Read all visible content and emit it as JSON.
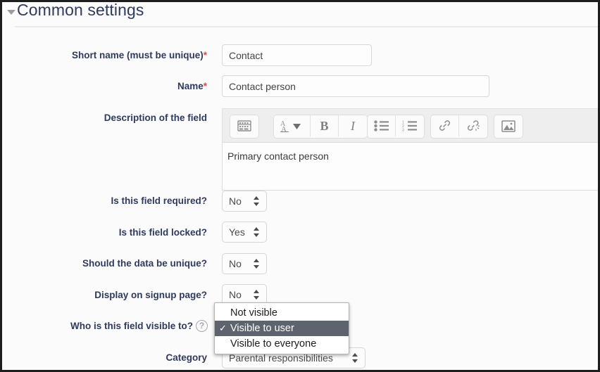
{
  "section": {
    "title": "Common settings",
    "collapse_icon": "triangle-down-icon"
  },
  "fields": {
    "short_name": {
      "label": "Short name (must be unique)",
      "required_marker": "*",
      "value": "Contact"
    },
    "name": {
      "label": "Name",
      "required_marker": "*",
      "value": "Contact person"
    },
    "description": {
      "label": "Description of the field",
      "value": "Primary contact person"
    },
    "is_required": {
      "label": "Is this field required?",
      "value": "No"
    },
    "is_locked": {
      "label": "Is this field locked?",
      "value": "Yes"
    },
    "unique_data": {
      "label": "Should the data be unique?",
      "value": "No"
    },
    "signup_page": {
      "label": "Display on signup page?",
      "value": "No"
    },
    "visible_to": {
      "label": "Who is this field visible to?",
      "help_icon": "question-mark-icon",
      "help_glyph": "?",
      "value": "Visible to user"
    },
    "category": {
      "label": "Category",
      "value": "Parental responsibilities"
    }
  },
  "editor_toolbar": {
    "buttons": [
      {
        "name": "expand-toolbar-icon",
        "glyph": ""
      },
      {
        "name": "font-size-icon",
        "glyph": ""
      },
      {
        "name": "bold-icon",
        "glyph": "B"
      },
      {
        "name": "italic-icon",
        "glyph": "I"
      },
      {
        "name": "bulleted-list-icon",
        "glyph": ""
      },
      {
        "name": "numbered-list-icon",
        "glyph": ""
      },
      {
        "name": "link-icon",
        "glyph": ""
      },
      {
        "name": "unlink-icon",
        "glyph": ""
      },
      {
        "name": "insert-image-icon",
        "glyph": ""
      }
    ]
  },
  "dropdown": {
    "open": true,
    "check_glyph": "✓",
    "options": [
      {
        "label": "Not visible",
        "selected": false
      },
      {
        "label": "Visible to user",
        "selected": true
      },
      {
        "label": "Visible to everyone",
        "selected": false
      }
    ]
  },
  "colors": {
    "label_text": "#2f3a5e",
    "required_star": "#e8493b",
    "menu_highlight": "#5e646e",
    "frame_border": "#1d1d1d",
    "page_background": "#fbfbfb"
  }
}
